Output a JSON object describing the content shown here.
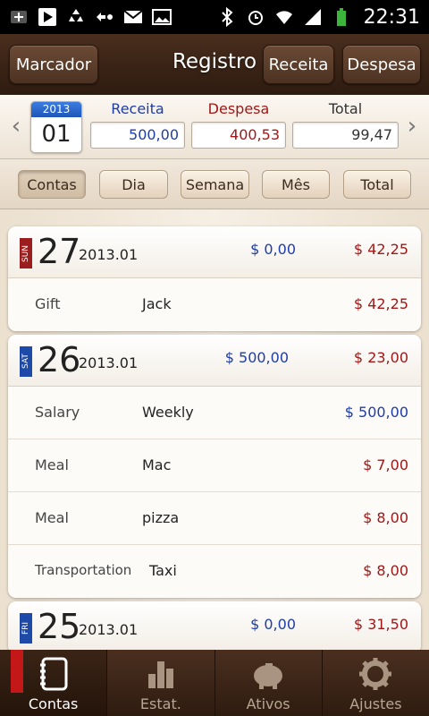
{
  "statusbar": {
    "time": "22:31",
    "icons": [
      "usb-icon",
      "play-icon",
      "recycle-icon",
      "arrows-icon",
      "gmail-icon",
      "picture-icon",
      "bluetooth-icon",
      "alarm-icon",
      "wifi-icon",
      "signal-icon",
      "battery-icon"
    ]
  },
  "header": {
    "left_button": "Marcador",
    "title": "Registro",
    "income_button": "Receita",
    "expense_button": "Despesa"
  },
  "summary": {
    "year": "2013",
    "month": "01",
    "income_label": "Receita",
    "income_value": "500,00",
    "expense_label": "Despesa",
    "expense_value": "400,53",
    "total_label": "Total",
    "total_value": "99,47"
  },
  "tabs": [
    "Contas",
    "Dia",
    "Semana",
    "Mês",
    "Total"
  ],
  "active_tab": "Contas",
  "days": [
    {
      "dow": "SUN",
      "day": "27",
      "ym": "2013.01",
      "income": "$ 0,00",
      "expense": "$ 42,25",
      "rows": [
        {
          "category": "Gift",
          "memo": "Jack",
          "amount": "$ 42,25",
          "type": "expense"
        }
      ]
    },
    {
      "dow": "SAT",
      "day": "26",
      "ym": "2013.01",
      "income": "$ 500,00",
      "expense": "$ 23,00",
      "rows": [
        {
          "category": "Salary",
          "memo": "Weekly",
          "amount": "$ 500,00",
          "type": "income"
        },
        {
          "category": "Meal",
          "memo": "Mac",
          "amount": "$ 7,00",
          "type": "expense"
        },
        {
          "category": "Meal",
          "memo": "pizza",
          "amount": "$ 8,00",
          "type": "expense"
        },
        {
          "category": "Transportation",
          "memo": "Taxi",
          "amount": "$ 8,00",
          "type": "expense"
        }
      ]
    },
    {
      "dow": "FRI",
      "day": "25",
      "ym": "2013.01",
      "income": "$ 0,00",
      "expense": "$ 31,50",
      "rows": []
    }
  ],
  "bottomnav": [
    {
      "label": "Contas",
      "icon": "notebook-icon"
    },
    {
      "label": "Estat.",
      "icon": "bar-chart-icon"
    },
    {
      "label": "Ativos",
      "icon": "piggy-bank-icon"
    },
    {
      "label": "Ajustes",
      "icon": "gear-icon"
    }
  ],
  "colors": {
    "income": "#1f3da6",
    "expense": "#a01818",
    "header_brown": "#3b2416",
    "sunday": "#9b1d1d",
    "weekday": "#1d4aa8"
  }
}
